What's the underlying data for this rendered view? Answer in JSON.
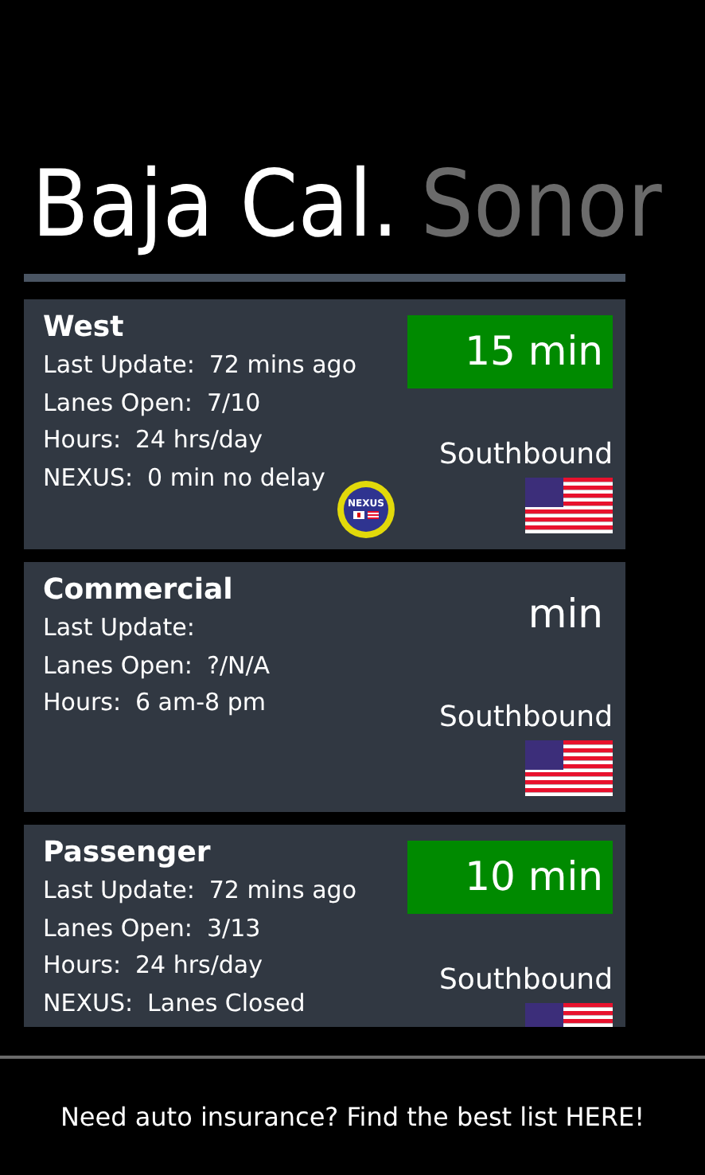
{
  "pivot_headers": [
    {
      "label": "Baja Cal.",
      "selected": true
    },
    {
      "label": "Sonor",
      "selected": false
    }
  ],
  "crossings": [
    {
      "name": "West",
      "wait": "15 min",
      "wait_highlight": true,
      "lines": [
        {
          "label": "Last Update:",
          "value": "72 mins ago"
        },
        {
          "label": "Lanes Open:",
          "value": "7/10"
        },
        {
          "label": "Hours:",
          "value": "24 hrs/day"
        },
        {
          "label": "NEXUS:",
          "value": "0 min no delay"
        }
      ],
      "nexus_badge": {
        "label": "NEXUS"
      },
      "direction": "Southbound"
    },
    {
      "name": "Commercial",
      "wait": "min",
      "wait_highlight": false,
      "lines": [
        {
          "label": "Last Update:"
        },
        {
          "label": "Lanes Open:",
          "value": "?/N/A"
        },
        {
          "label": "Hours:",
          "value": "6 am-8 pm"
        }
      ],
      "direction": "Southbound"
    },
    {
      "name": "Passenger",
      "wait": "10 min",
      "wait_highlight": true,
      "lines": [
        {
          "label": "Last Update:",
          "value": "72 mins ago"
        },
        {
          "label": "Lanes Open:",
          "value": "3/13"
        },
        {
          "label": "Hours:",
          "value": "24 hrs/day"
        },
        {
          "label": "NEXUS:",
          "value": "Lanes Closed"
        }
      ],
      "direction": "Southbound"
    }
  ],
  "ad_banner": {
    "text": "Need auto insurance? Find the best list HERE!"
  }
}
